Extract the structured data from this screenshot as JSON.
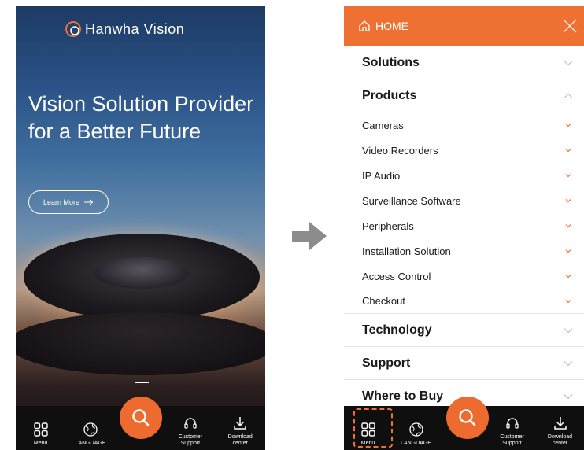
{
  "left": {
    "brand": "Hanwha Vision",
    "hero_title": "Vision Solution Provider for a Better Future",
    "learn_more": "Learn More"
  },
  "right": {
    "home_label": "HOME",
    "menu": [
      {
        "label": "Solutions",
        "expanded": false
      },
      {
        "label": "Products",
        "expanded": true,
        "children": [
          "Cameras",
          "Video Recorders",
          "IP Audio",
          "Surveillance Software",
          "Peripherals",
          "Installation Solution",
          "Access Control",
          "Checkout"
        ]
      },
      {
        "label": "Technology",
        "expanded": false
      },
      {
        "label": "Support",
        "expanded": false
      },
      {
        "label": "Where to Buy",
        "expanded": false
      }
    ]
  },
  "bottom_nav": {
    "menu": "Menu",
    "language": "LANGUAGE",
    "customer_support_1": "Customer",
    "customer_support_2": "Support",
    "download_1": "Download",
    "download_2": "center"
  },
  "colors": {
    "accent": "#ee7033",
    "nav_bg": "#0f0f10"
  }
}
